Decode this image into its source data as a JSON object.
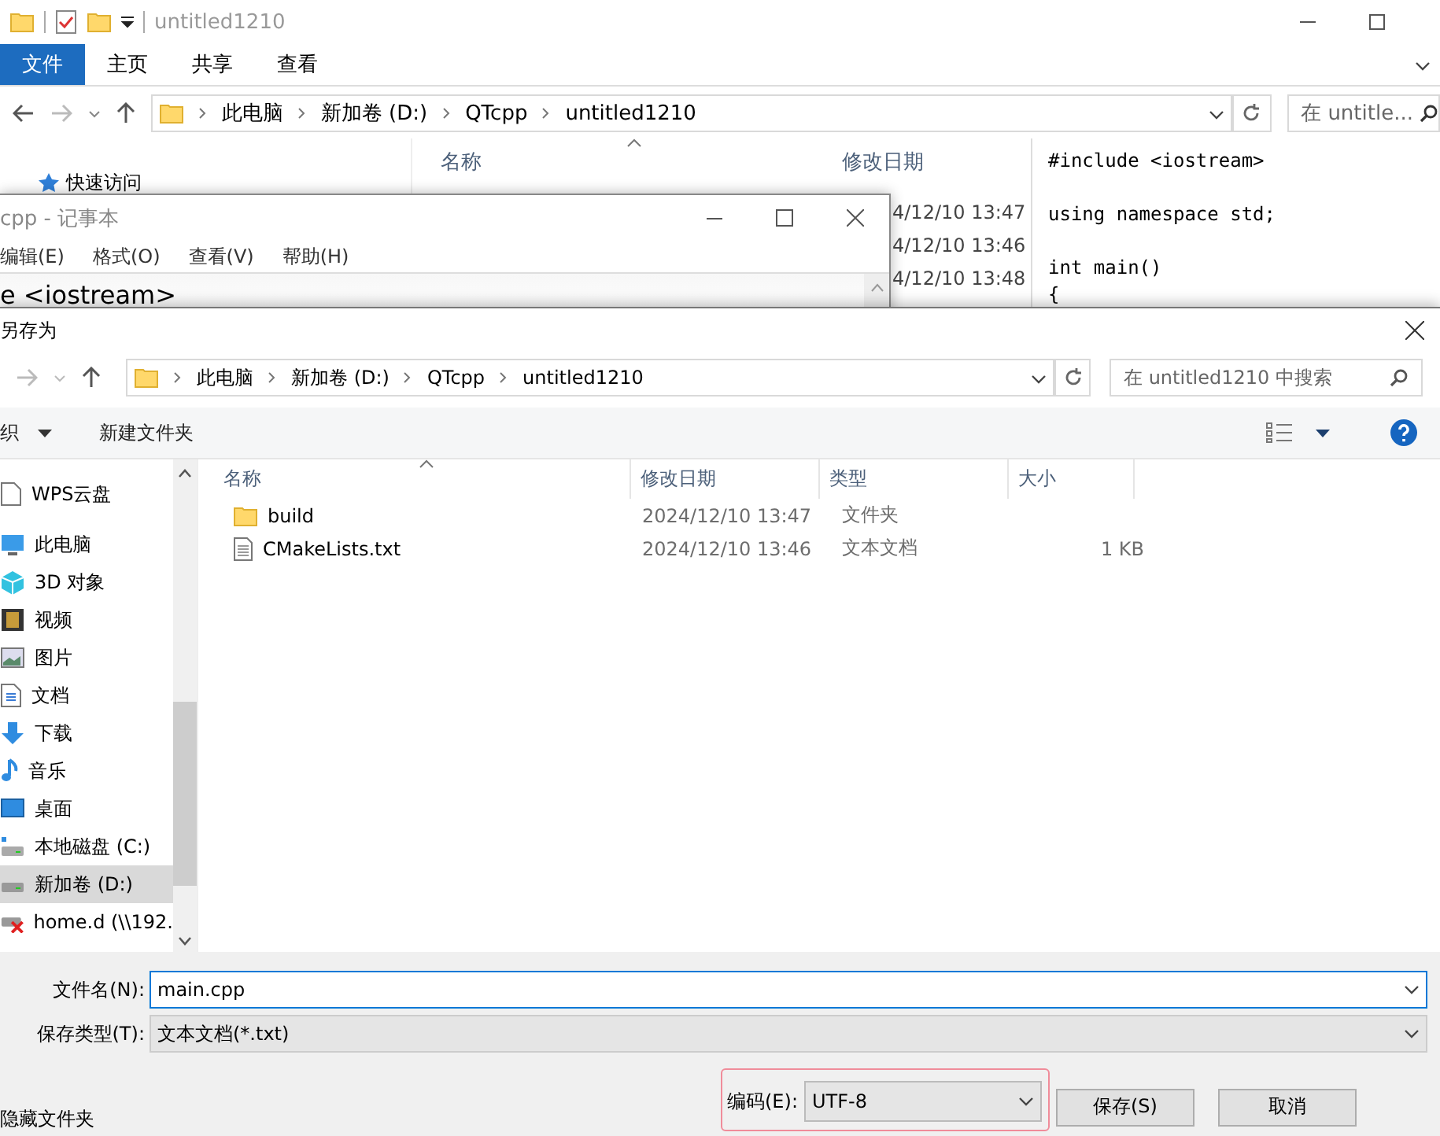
{
  "explorer": {
    "title": "untitled1210",
    "ribbon_tabs": [
      {
        "label": "文件",
        "selected": true
      },
      {
        "label": "主页",
        "selected": false
      },
      {
        "label": "共享",
        "selected": false
      },
      {
        "label": "查看",
        "selected": false
      }
    ],
    "breadcrumb": [
      "此电脑",
      "新加卷 (D:)",
      "QTcpp",
      "untitled1210"
    ],
    "search": {
      "placeholder": "在 untitle..."
    },
    "sidebar_items": [
      "快速访问"
    ],
    "columns": [
      "名称",
      "修改日期"
    ],
    "dates": [
      "4/12/10 13:47",
      "4/12/10 13:46",
      "4/12/10 13:48"
    ],
    "preview_blocks": [
      [
        "#include <iostream>"
      ],
      [
        "using namespace std;"
      ],
      [
        "int main()",
        "{"
      ]
    ]
  },
  "notepad": {
    "title": "cpp - 记事本",
    "menu": [
      "编辑(E)",
      "格式(O)",
      "查看(V)",
      "帮助(H)"
    ],
    "text": "e <iostream>"
  },
  "save_dialog": {
    "title": "另存为",
    "breadcrumb": [
      "此电脑",
      "新加卷 (D:)",
      "QTcpp",
      "untitled1210"
    ],
    "search": {
      "placeholder": "在 untitled1210 中搜索"
    },
    "toolbar": [
      "织",
      "新建文件夹"
    ],
    "nav_items": [
      {
        "label": "WPS云盘",
        "kind": "cloud",
        "selected": false
      },
      {
        "label": "此电脑",
        "kind": "pc",
        "selected": false
      },
      {
        "label": "3D 对象",
        "kind": "cube",
        "selected": false
      },
      {
        "label": "视频",
        "kind": "video",
        "selected": false
      },
      {
        "label": "图片",
        "kind": "image",
        "selected": false
      },
      {
        "label": "文档",
        "kind": "doc",
        "selected": false
      },
      {
        "label": "下载",
        "kind": "download",
        "selected": false
      },
      {
        "label": "音乐",
        "kind": "music",
        "selected": false
      },
      {
        "label": "桌面",
        "kind": "desktop",
        "selected": false
      },
      {
        "label": "本地磁盘 (C:)",
        "kind": "sysdrive",
        "selected": false
      },
      {
        "label": "新加卷 (D:)",
        "kind": "drive",
        "selected": true
      },
      {
        "label": "home.d (\\\\192.",
        "kind": "netdrive",
        "selected": false
      }
    ],
    "columns": [
      "名称",
      "修改日期",
      "类型",
      "大小"
    ],
    "files": [
      {
        "name": "build",
        "kind": "folder",
        "modified": "2024/12/10 13:47",
        "type": "文件夹"
      },
      {
        "name": "CMakeLists.txt",
        "kind": "text",
        "modified": "2024/12/10 13:46",
        "type": "文本文档",
        "size": "1 KB"
      }
    ],
    "file_name": {
      "label": "文件名(N):",
      "value": "main.cpp"
    },
    "file_type": {
      "label": "保存类型(T):",
      "value": "文本文档(*.txt)"
    },
    "hide_folders": "隐藏文件夹",
    "encoding": {
      "label": "编码(E):",
      "value": "UTF-8"
    },
    "buttons": [
      "保存(S)",
      "取消"
    ]
  }
}
